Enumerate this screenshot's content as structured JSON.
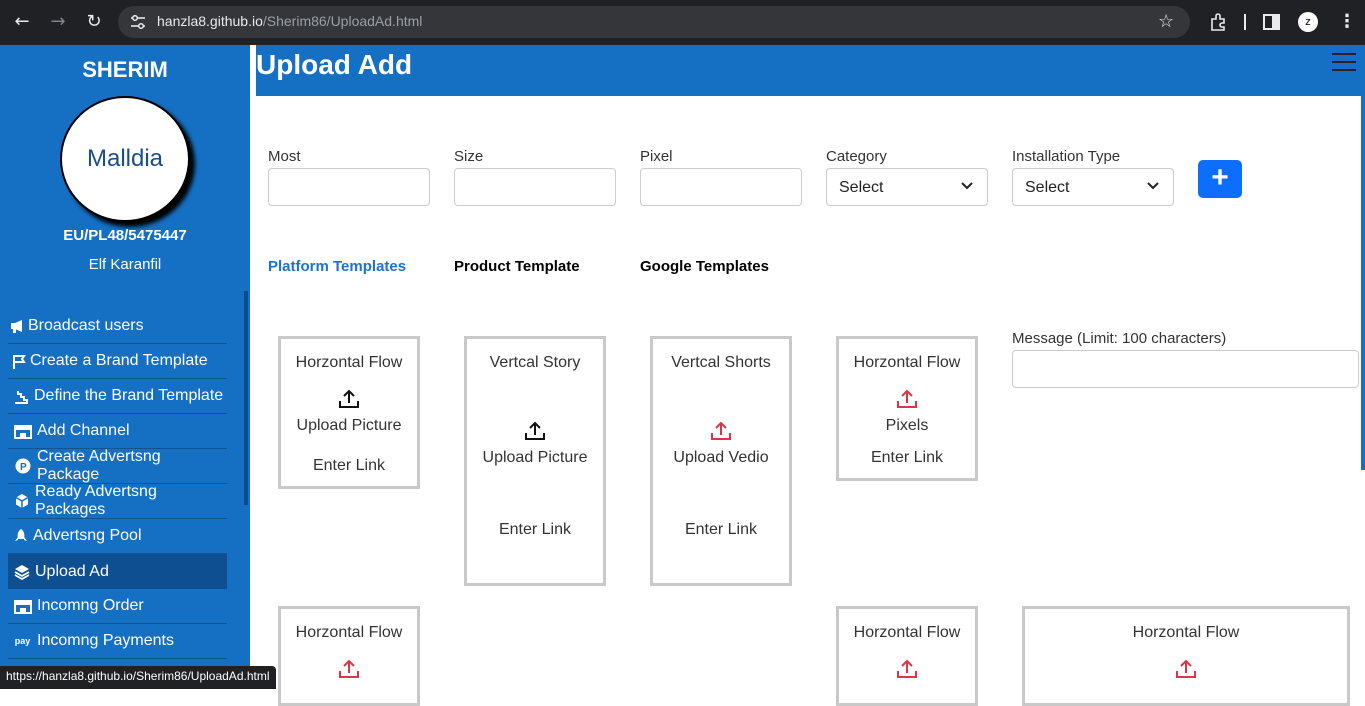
{
  "browser": {
    "url_host": "hanzla8.github.io",
    "url_path": "/Sherim86/UploadAd.html",
    "status_url": "https://hanzla8.github.io/Sherim86/UploadAd.html"
  },
  "sidebar": {
    "brand": "SHERIM",
    "avatar_text": "Malldia",
    "user_id": "EU/PL48/5475447",
    "user_name": "Elf Karanfil",
    "items": [
      {
        "label": "Broadcast users",
        "icon": "megaphone-icon"
      },
      {
        "label": "Create a Brand Template",
        "icon": "flag-icon"
      },
      {
        "label": "Define the Brand Template",
        "icon": "stairs-icon"
      },
      {
        "label": "Add Channel",
        "icon": "store-icon"
      },
      {
        "label": "Create Advertsng Package",
        "icon": "parking-icon"
      },
      {
        "label": "Ready Advertsng Packages",
        "icon": "cube-icon"
      },
      {
        "label": "Advertsng Pool",
        "icon": "rocket-icon"
      },
      {
        "label": "Upload Ad",
        "icon": "layers-icon",
        "active": true
      },
      {
        "label": "Incomng Order",
        "icon": "store-icon"
      },
      {
        "label": "Incomng Payments",
        "icon": "pay-icon"
      }
    ]
  },
  "header": {
    "title": "Upload Add"
  },
  "form": {
    "most_label": "Most",
    "size_label": "Size",
    "pixel_label": "Pixel",
    "category_label": "Category",
    "category_value": "Select",
    "install_label": "Installation Type",
    "install_value": "Select",
    "add_label": "+"
  },
  "tabs": [
    "Platform Templates",
    "Product Template",
    "Google Templates"
  ],
  "cards": {
    "c1": {
      "title": "Horzontal Flow",
      "upload": "Upload Picture",
      "link": "Enter Link"
    },
    "c2": {
      "title": "Vertcal Story",
      "upload": "Upload Picture",
      "link": "Enter Link"
    },
    "c3": {
      "title": "Vertcal Shorts",
      "upload": "Upload Vedio",
      "link": "Enter Link"
    },
    "c4": {
      "title": "Horzontal Flow",
      "upload": "Pixels",
      "link": "Enter Link"
    },
    "c5": {
      "title": "Horzontal Flow"
    },
    "c6": {
      "title": "Horzontal Flow"
    },
    "c7": {
      "title": "Horzontal Flow"
    }
  },
  "message": {
    "label": "Message (Limit: 100 characters)"
  },
  "colors": {
    "primary": "#1570c4",
    "button": "#0d6efd",
    "red_icon": "#dc3545"
  }
}
